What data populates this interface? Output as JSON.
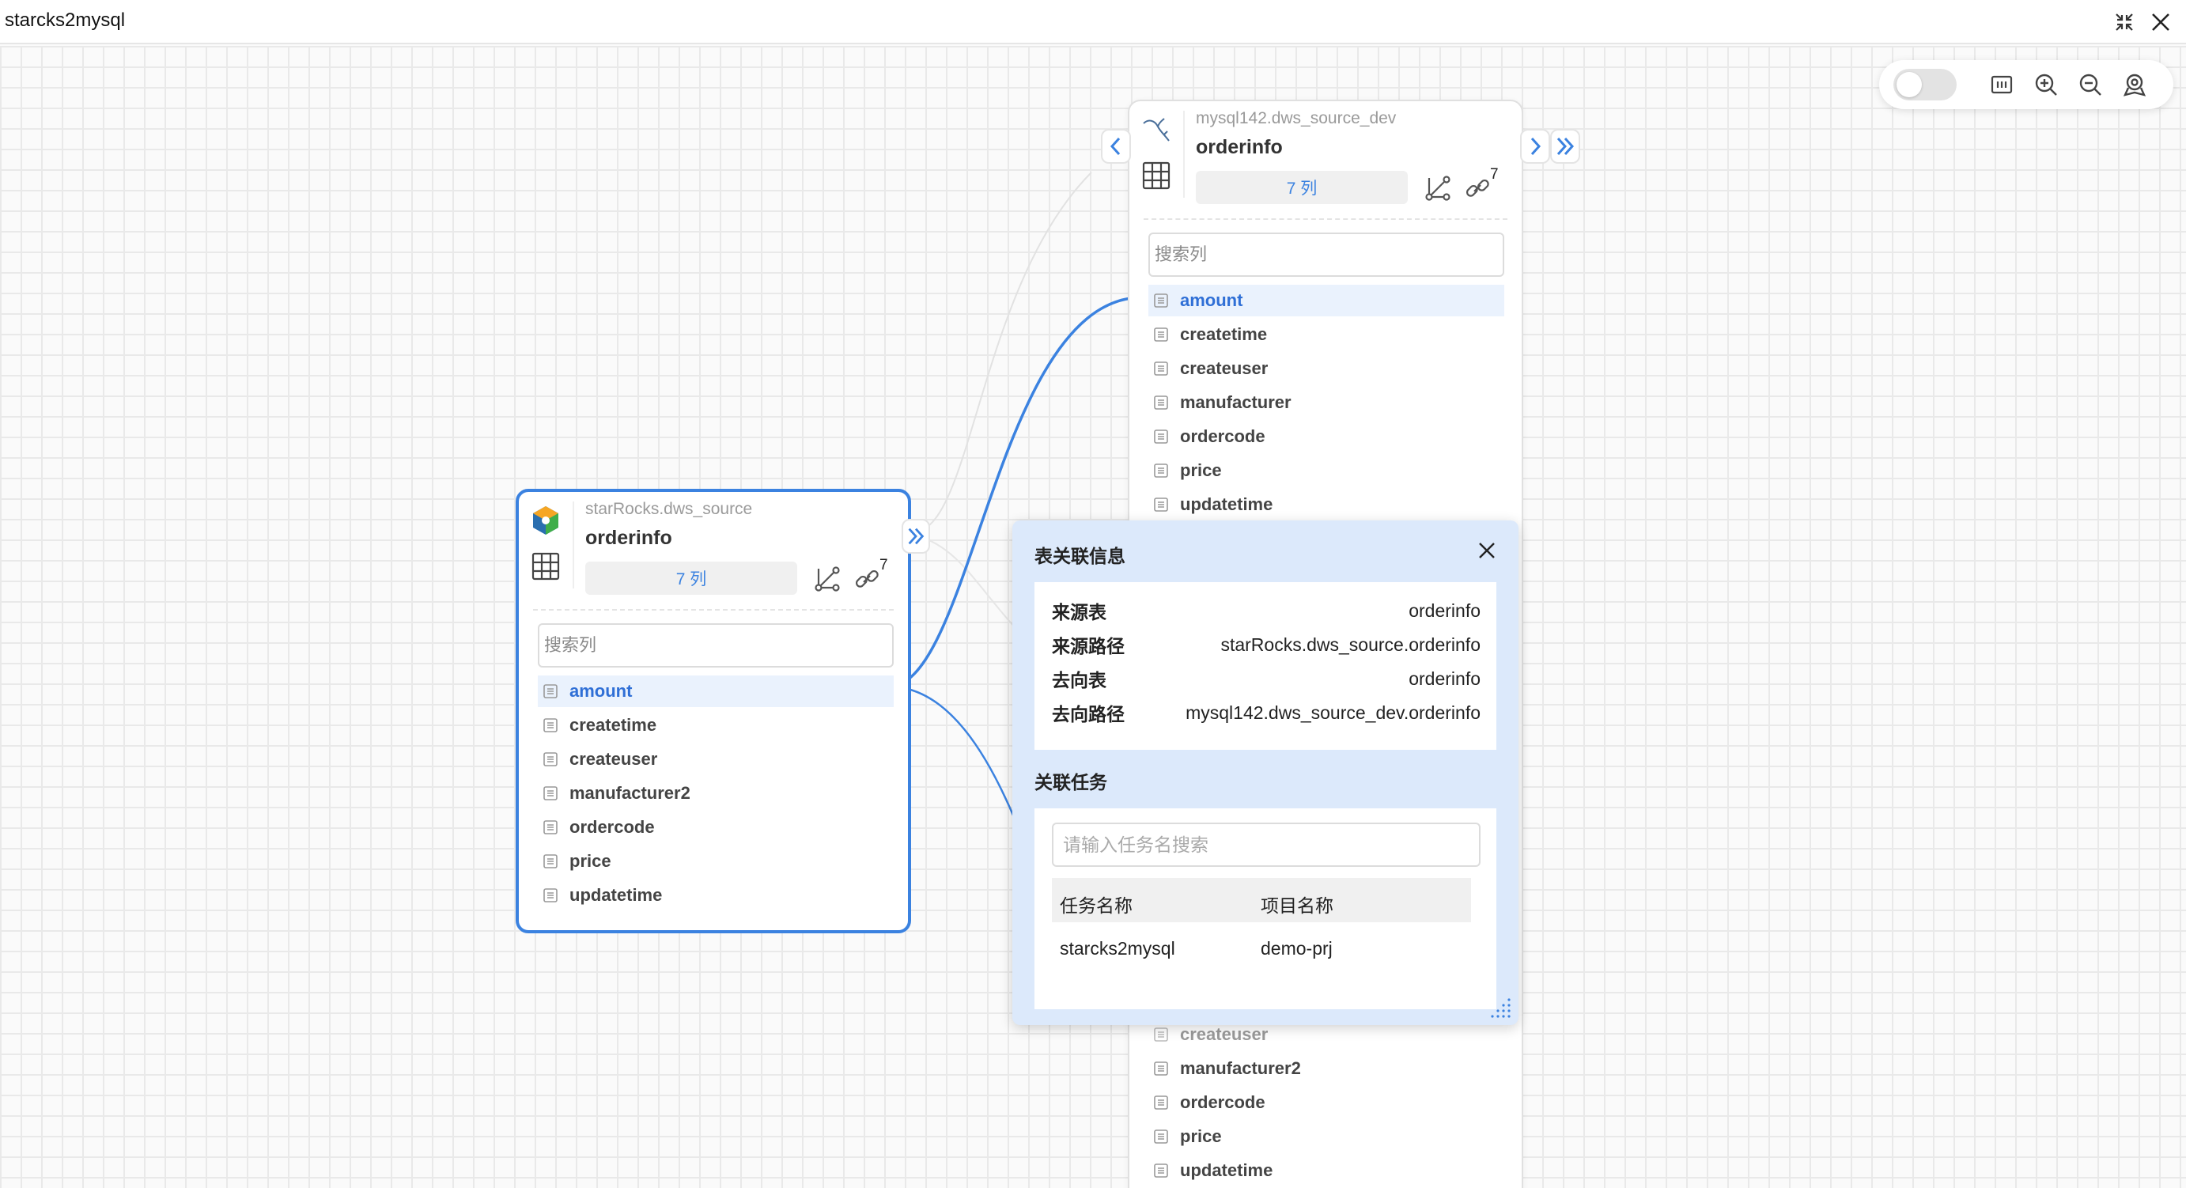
{
  "window": {
    "title": "starcks2mysql"
  },
  "colors": {
    "accent": "#3b82e0",
    "active_bg": "#eaf2fd",
    "popup_bg": "#dce9fb"
  },
  "toolbar": {
    "toggle_state": "off",
    "icons": [
      "toggle-switch",
      "minimap-icon",
      "zoom-in-icon",
      "zoom-out-icon",
      "locate-icon"
    ]
  },
  "source_table": {
    "db_icon": "starrocks-logo",
    "path": "starRocks.dws_source",
    "name": "orderinfo",
    "col_count": "7 列",
    "link_count": "7",
    "search_placeholder": "搜索列",
    "columns": [
      "amount",
      "createtime",
      "createuser",
      "manufacturer2",
      "ordercode",
      "price",
      "updatetime"
    ],
    "active_column": "amount"
  },
  "target_table": {
    "db_icon": "mysql-logo",
    "path": "mysql142.dws_source_dev",
    "name": "orderinfo",
    "col_count": "7 列",
    "link_count": "7",
    "search_placeholder": "搜索列",
    "columns": [
      "amount",
      "createtime",
      "createuser",
      "manufacturer",
      "ordercode",
      "price",
      "updatetime"
    ],
    "active_column": "amount",
    "lower_columns": [
      "createuser",
      "manufacturer2",
      "ordercode",
      "price",
      "updatetime"
    ]
  },
  "popup": {
    "title": "表关联信息",
    "info": [
      {
        "key": "来源表",
        "value": "orderinfo"
      },
      {
        "key": "来源路径",
        "value": "starRocks.dws_source.orderinfo"
      },
      {
        "key": "去向表",
        "value": "orderinfo"
      },
      {
        "key": "去向路径",
        "value": "mysql142.dws_source_dev.orderinfo"
      }
    ],
    "tasks_title": "关联任务",
    "task_search_placeholder": "请输入任务名搜索",
    "task_headers": [
      "任务名称",
      "项目名称"
    ],
    "tasks": [
      {
        "name": "starcks2mysql",
        "project": "demo-prj"
      }
    ]
  }
}
